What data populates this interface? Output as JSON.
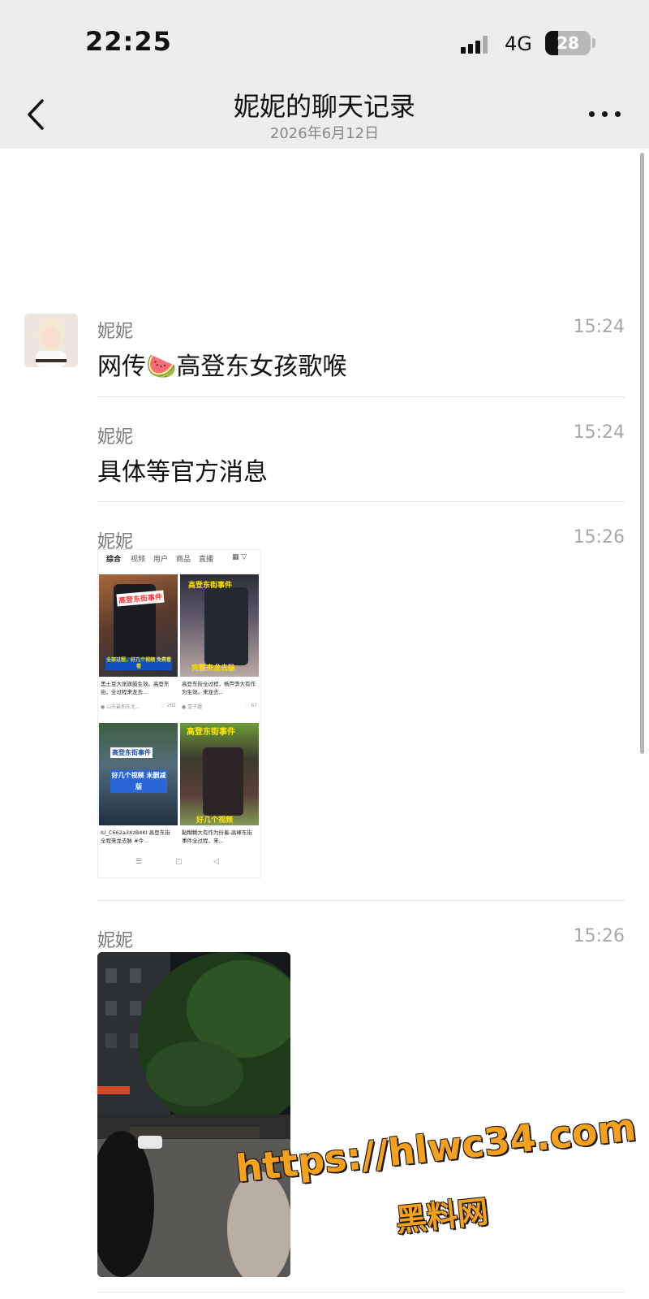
{
  "status_bar": {
    "time": "22:25",
    "network": "4G",
    "battery": "28",
    "battery_level": 0.28
  },
  "header": {
    "title": "妮妮的聊天记录",
    "subtitle": "2026年6月12日"
  },
  "messages": [
    {
      "sender": "妮妮",
      "time": "15:24",
      "text_before": "网传",
      "emoji": "🍉",
      "text_after": "高登东女孩歌喉"
    },
    {
      "sender": "妮妮",
      "time": "15:24",
      "text": "具体等官方消息"
    },
    {
      "sender": "妮妮",
      "time": "15:26",
      "type": "image"
    },
    {
      "sender": "妮妮",
      "time": "15:26",
      "type": "image"
    }
  ],
  "screenshot": {
    "tabs": [
      "综合",
      "视频",
      "用户",
      "商品",
      "直播"
    ],
    "cards": [
      {
        "overlay_top": "高登东街事件",
        "overlay_bottom": "全部过程，好几个视频 免费看看",
        "caption": "黑土豆大张旗鼓生效。高登东街，全过程来龙去...",
        "likes": "♡ 262"
      },
      {
        "overlay_top": "高登东街事件",
        "overlay_bottom": "完整来龙去脉",
        "caption": "高登东街全过程，杨芦笋大有作为生效。来龙去...",
        "likes": "♡ 67"
      },
      {
        "overlay_top": "高登东街事件",
        "overlay_bottom": "好几个视频 未删减版",
        "caption": "IU_C662a3XzB4KI 高登东街 全程来龙去脉 #今...",
        "likes": ""
      },
      {
        "overlay_top": "高登东街事件",
        "overlay_bottom": "好几个视频",
        "caption": "黏糊糊大有作为份着-高峰东街事件全过程，来...",
        "likes": ""
      }
    ]
  },
  "watermark": {
    "url": "https://hlwc34.com",
    "name": "黑料网"
  }
}
